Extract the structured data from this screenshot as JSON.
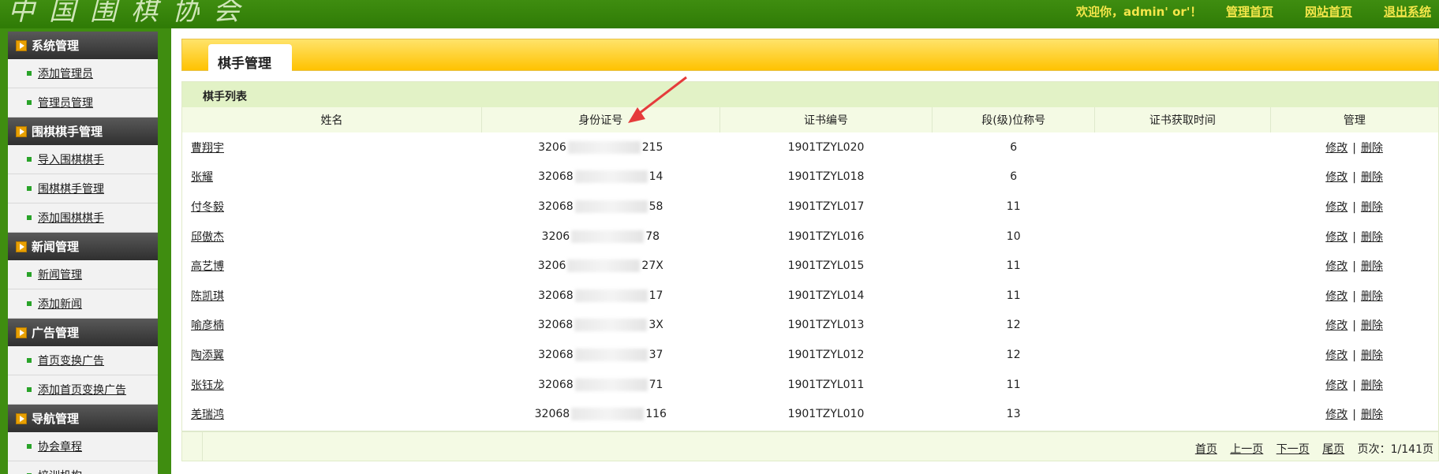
{
  "header": {
    "logo_text": "中国围棋协会",
    "welcome": "欢迎你，admin' or'！",
    "links": [
      "管理首页",
      "网站首页",
      "退出系统"
    ]
  },
  "sidebar": {
    "sections": [
      {
        "title": "系统管理",
        "items": [
          "添加管理员",
          "管理员管理"
        ]
      },
      {
        "title": "围棋棋手管理",
        "items": [
          "导入围棋棋手",
          "围棋棋手管理",
          "添加围棋棋手"
        ]
      },
      {
        "title": "新闻管理",
        "items": [
          "新闻管理",
          "添加新闻"
        ]
      },
      {
        "title": "广告管理",
        "items": [
          "首页变换广告",
          "添加首页变换广告"
        ]
      },
      {
        "title": "导航管理",
        "items": [
          "协会章程",
          "培训机构"
        ]
      }
    ]
  },
  "main": {
    "page_title": "棋手管理",
    "panel_title": "棋手列表",
    "columns": [
      "姓名",
      "身份证号",
      "证书编号",
      "段(级)位称号",
      "证书获取时间",
      "管理"
    ],
    "rows": [
      {
        "name": "曹翔宇",
        "id_prefix": "3206",
        "id_suffix": "215",
        "cert": "1901TZYL020",
        "rank": "6",
        "time": ""
      },
      {
        "name": "张耀",
        "id_prefix": "32068",
        "id_suffix": "14",
        "cert": "1901TZYL018",
        "rank": "6",
        "time": ""
      },
      {
        "name": "付冬毅",
        "id_prefix": "32068",
        "id_suffix": "58",
        "cert": "1901TZYL017",
        "rank": "11",
        "time": ""
      },
      {
        "name": "邱傲杰",
        "id_prefix": "3206",
        "id_suffix": "78",
        "cert": "1901TZYL016",
        "rank": "10",
        "time": ""
      },
      {
        "name": "高艺博",
        "id_prefix": "3206",
        "id_suffix": "27X",
        "cert": "1901TZYL015",
        "rank": "11",
        "time": ""
      },
      {
        "name": "陈凯琪",
        "id_prefix": "32068",
        "id_suffix": "17",
        "cert": "1901TZYL014",
        "rank": "11",
        "time": ""
      },
      {
        "name": "喻彦楠",
        "id_prefix": "32068",
        "id_suffix": "3X",
        "cert": "1901TZYL013",
        "rank": "12",
        "time": ""
      },
      {
        "name": "陶添翼",
        "id_prefix": "32068",
        "id_suffix": "37",
        "cert": "1901TZYL012",
        "rank": "12",
        "time": ""
      },
      {
        "name": "张钰龙",
        "id_prefix": "32068",
        "id_suffix": "71",
        "cert": "1901TZYL011",
        "rank": "11",
        "time": ""
      },
      {
        "name": "羌瑞鸿",
        "id_prefix": "32068",
        "id_suffix": "116",
        "cert": "1901TZYL010",
        "rank": "13",
        "time": ""
      }
    ],
    "actions": {
      "edit": "修改",
      "sep": "|",
      "delete": "删除"
    },
    "pager": {
      "first": "首页",
      "prev": "上一页",
      "next": "下一页",
      "last": "尾页",
      "info": "页次：1/141页"
    }
  },
  "colors": {
    "header_green": "#3f8d10",
    "link_yellow": "#f4e64a",
    "title_gold": "#ffc200",
    "panel_green": "#e2f2c6",
    "arrow_red": "#e53b3b"
  }
}
